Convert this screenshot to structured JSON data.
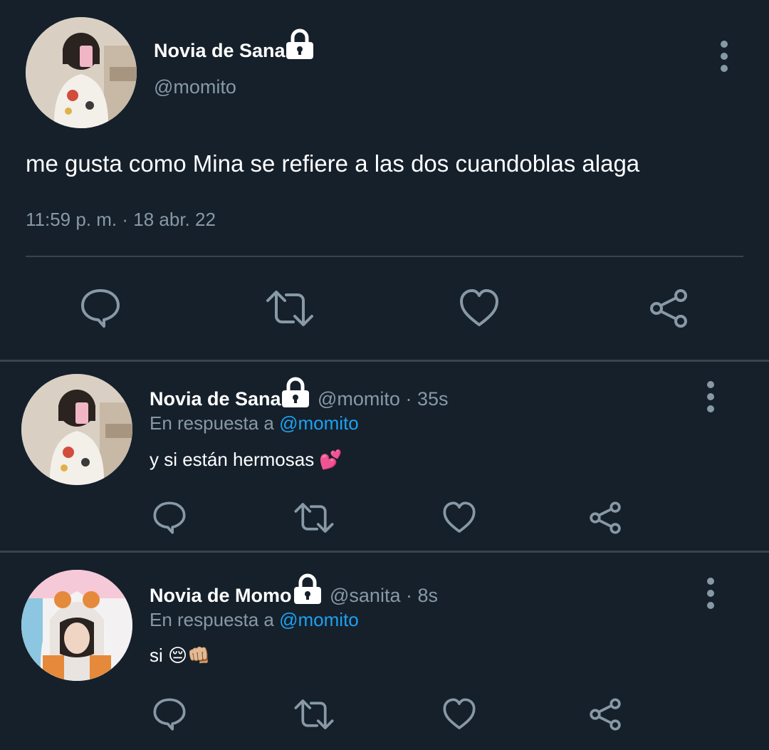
{
  "main_tweet": {
    "display_name": "Novia de Sana",
    "handle": "@momito",
    "text": "me gusta como Mina se refiere a las dos cuandoblas alaga",
    "timestamp": "11:59 p. m. · 18 abr. 22"
  },
  "replies": [
    {
      "display_name": "Novia de Sana",
      "handle": "@momito",
      "age": "· 35s",
      "reply_prefix": "En respuesta a",
      "reply_mention": "@momito",
      "text": "y si están hermosas 💕"
    },
    {
      "display_name": "Novia de Momo",
      "handle": "@sanita",
      "age": "· 8s",
      "reply_prefix": "En respuesta a",
      "reply_mention": "@momito",
      "text": "si 😔👊🏼"
    }
  ],
  "icons": {
    "lock": "lock-icon",
    "more": "more-vertical-icon",
    "reply": "reply-icon",
    "retweet": "retweet-icon",
    "like": "heart-icon",
    "share": "share-icon"
  },
  "colors": {
    "background": "#15202b",
    "secondary_text": "#8899a6",
    "link": "#1da1f2",
    "divider": "#38444d"
  }
}
